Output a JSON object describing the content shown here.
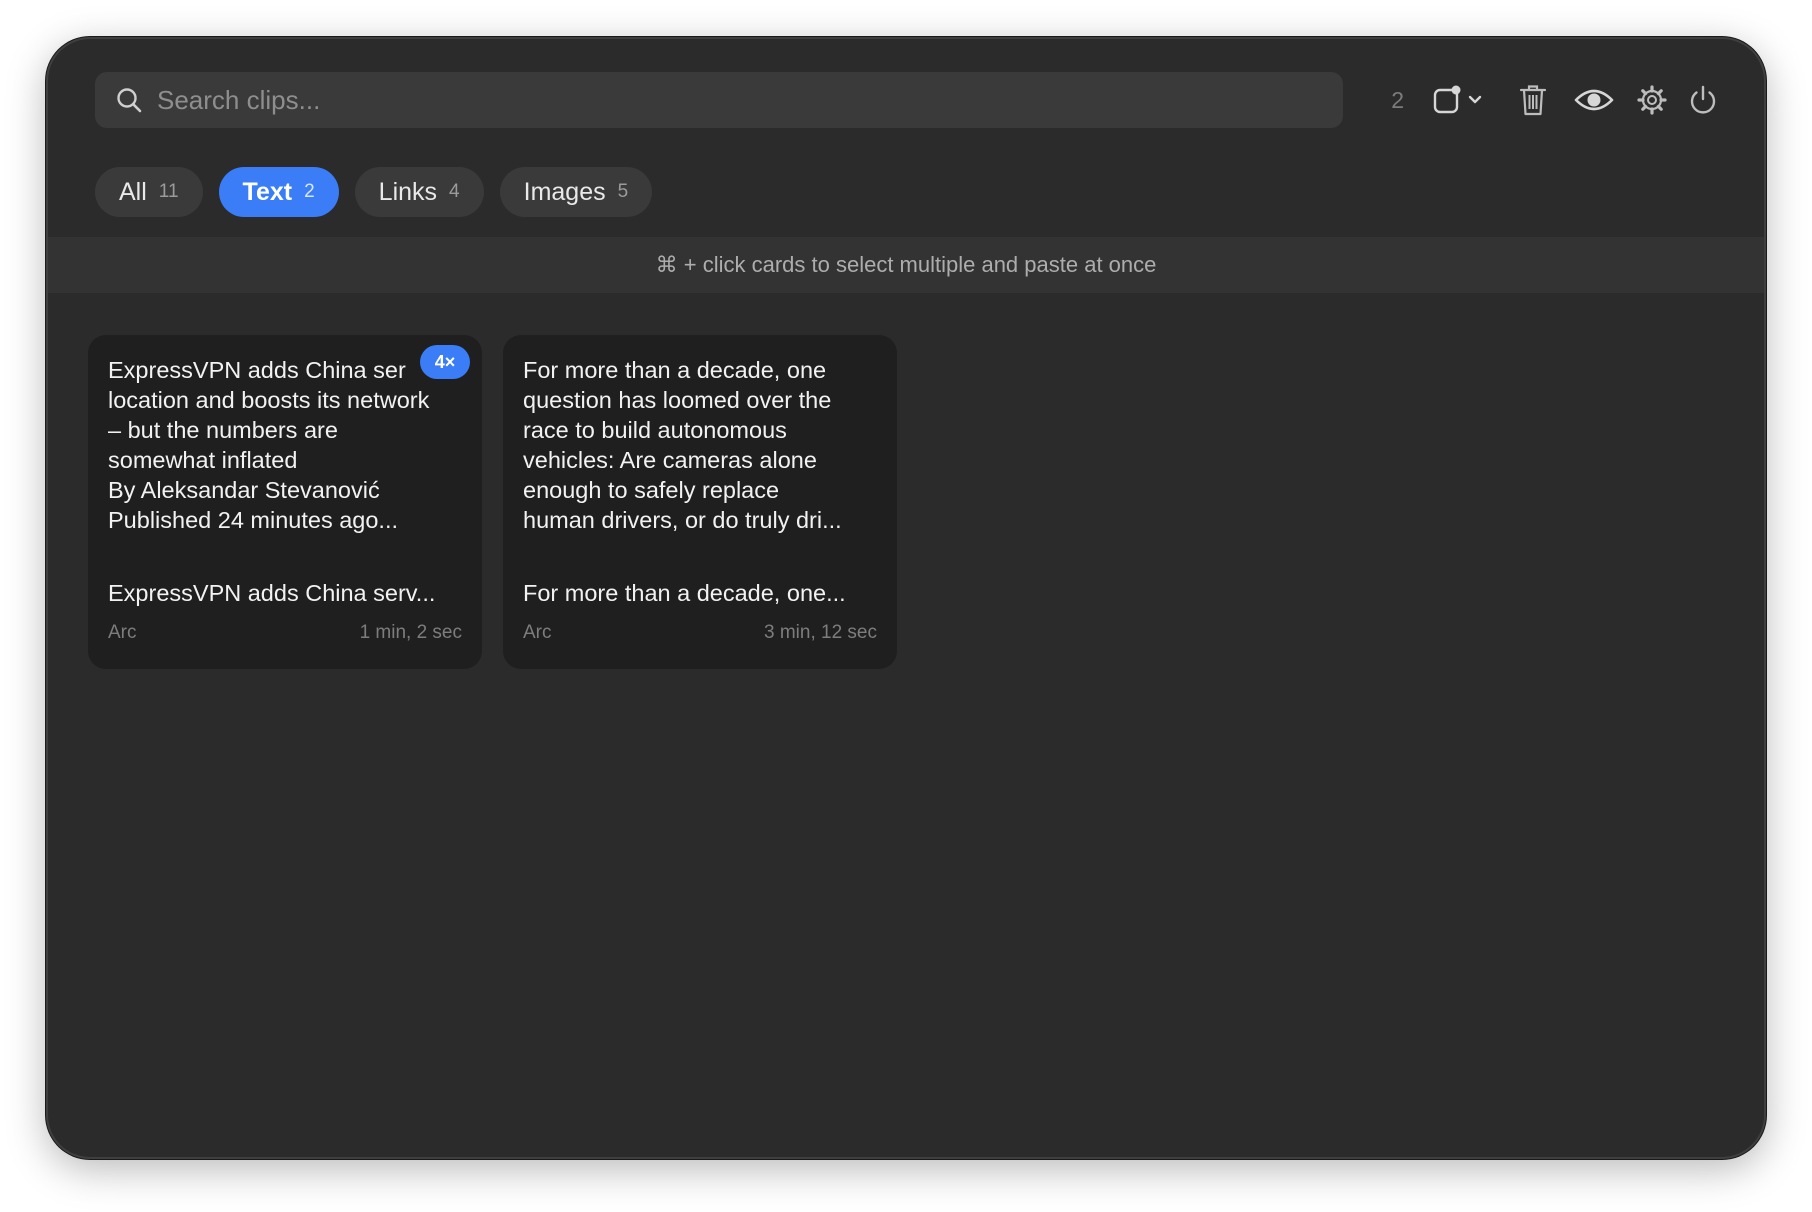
{
  "search": {
    "placeholder": "Search clips..."
  },
  "toolbar": {
    "selected_count": "2",
    "icons": [
      "window-dropdown-icon",
      "trash-icon",
      "eye-icon",
      "gear-icon",
      "power-icon"
    ]
  },
  "tabs": [
    {
      "label": "All",
      "count": "11",
      "active": false
    },
    {
      "label": "Text",
      "count": "2",
      "active": true
    },
    {
      "label": "Links",
      "count": "4",
      "active": false
    },
    {
      "label": "Images",
      "count": "5",
      "active": false
    }
  ],
  "hint": "⌘ + click cards to select multiple and paste at once",
  "cards": [
    {
      "preview": "ExpressVPN adds China ser\nlocation and boosts its network\n– but the numbers are\nsomewhat inflated\nBy Aleksandar Stevanović\nPublished 24 minutes ago...",
      "badge": "4×",
      "title": "ExpressVPN adds China serv...",
      "source": "Arc",
      "time": "1 min, 2 sec"
    },
    {
      "preview": "For more than a decade, one\nquestion has loomed over the\nrace to build autonomous\nvehicles: Are cameras alone\nenough to safely replace\nhuman drivers, or do truly dri...",
      "title": "For more than a decade, one...",
      "source": "Arc",
      "time": "3 min, 12 sec"
    }
  ],
  "colors": {
    "window_bg": "#2b2b2b",
    "accent": "#3a7df6",
    "card_bg": "#1f1f1f",
    "pill_bg": "#3a3a3a"
  }
}
